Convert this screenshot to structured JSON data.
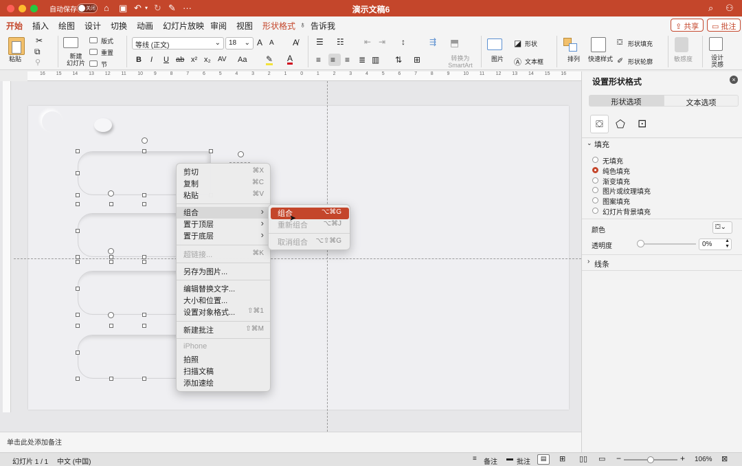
{
  "title_bar": {
    "autosave_label": "自动保存",
    "toggle_label": "关闭",
    "doc_title": "演示文稿6",
    "more": "···"
  },
  "tabs": [
    "开始",
    "插入",
    "绘图",
    "设计",
    "切换",
    "动画",
    "幻灯片放映",
    "审阅",
    "视图",
    "形状格式",
    "告诉我"
  ],
  "header_buttons": {
    "share": "共享",
    "comments": "批注"
  },
  "ribbon": {
    "paste": "粘贴",
    "new_slide_1": "新建",
    "new_slide_2": "幻灯片",
    "layout": "版式",
    "reset": "重置",
    "section": "节",
    "font_name": "等线 (正文)",
    "font_size": "18",
    "bold": "B",
    "italic": "I",
    "underline": "U",
    "strike": "ab",
    "superscript": "x²",
    "subscript": "x₂",
    "char_spacing": "AV",
    "change_case": "Aa",
    "grow_font": "A",
    "shrink_font": "A",
    "font_color": "A",
    "convert_smartart_1": "转换为",
    "convert_smartart_2": "SmartArt",
    "picture": "图片",
    "shapes": "形状",
    "textbox": "文本框",
    "arrange": "排列",
    "quick_styles": "快速样式",
    "shape_fill": "形状填充",
    "shape_outline": "形状轮廓",
    "sensitivity": "敏感度",
    "designer_1": "设计",
    "designer_2": "灵感"
  },
  "ruler_numbers": [
    "16",
    "15",
    "14",
    "13",
    "12",
    "11",
    "10",
    "9",
    "8",
    "7",
    "6",
    "5",
    "4",
    "3",
    "2",
    "1",
    "0",
    "1",
    "2",
    "3",
    "4",
    "5",
    "6",
    "7",
    "8",
    "9",
    "10",
    "11",
    "12",
    "13",
    "14",
    "15",
    "16"
  ],
  "context_menu": {
    "items": [
      {
        "label": "剪切",
        "shortcut": "⌘X",
        "state": "normal"
      },
      {
        "label": "复制",
        "shortcut": "⌘C",
        "state": "normal"
      },
      {
        "label": "粘贴",
        "shortcut": "⌘V",
        "state": "normal"
      },
      {
        "label": "组合",
        "shortcut": "›",
        "state": "highlight"
      },
      {
        "label": "置于顶层",
        "shortcut": "›",
        "state": "normal"
      },
      {
        "label": "置于底层",
        "shortcut": "›",
        "state": "normal"
      },
      {
        "label": "超链接...",
        "shortcut": "⌘K",
        "state": "disabled"
      },
      {
        "label": "另存为图片...",
        "shortcut": "",
        "state": "normal"
      },
      {
        "label": "编辑替换文字...",
        "shortcut": "",
        "state": "normal"
      },
      {
        "label": "大小和位置...",
        "shortcut": "",
        "state": "normal"
      },
      {
        "label": "设置对象格式...",
        "shortcut": "⇧⌘1",
        "state": "normal"
      },
      {
        "label": "新建批注",
        "shortcut": "⇧⌘M",
        "state": "normal"
      },
      {
        "label": "iPhone",
        "shortcut": "",
        "state": "disabled"
      },
      {
        "label": "拍照",
        "shortcut": "",
        "state": "normal"
      },
      {
        "label": "扫描文稿",
        "shortcut": "",
        "state": "normal"
      },
      {
        "label": "添加速绘",
        "shortcut": "",
        "state": "normal"
      }
    ]
  },
  "submenu": {
    "items": [
      {
        "label": "组合",
        "shortcut": "⌥⌘G",
        "state": "selected"
      },
      {
        "label": "重新组合",
        "shortcut": "⌥⌘J",
        "state": "disabled"
      },
      {
        "label": "取消组合",
        "shortcut": "⌥⇧⌘G",
        "state": "disabled"
      }
    ]
  },
  "format_pane": {
    "title": "设置形状格式",
    "seg_shape": "形状选项",
    "seg_text": "文本选项",
    "fill_section": "填充",
    "fill_options": [
      "无填充",
      "纯色填充",
      "渐变填充",
      "图片或纹理填充",
      "图案填充",
      "幻灯片背景填充"
    ],
    "selected_fill": "纯色填充",
    "color_label": "颜色",
    "transparency_label": "透明度",
    "transparency_value": "0%",
    "transparency_level": 0,
    "line_section": "线条"
  },
  "notes": {
    "placeholder": "单击此处添加备注"
  },
  "status": {
    "slide": "幻灯片 1 / 1",
    "language": "中文 (中国)",
    "notes_btn": "备注",
    "comments_btn": "批注",
    "zoom": "106%",
    "zoom_minus": "−",
    "zoom_plus": "+"
  },
  "colors": {
    "accent": "#c4462b"
  }
}
